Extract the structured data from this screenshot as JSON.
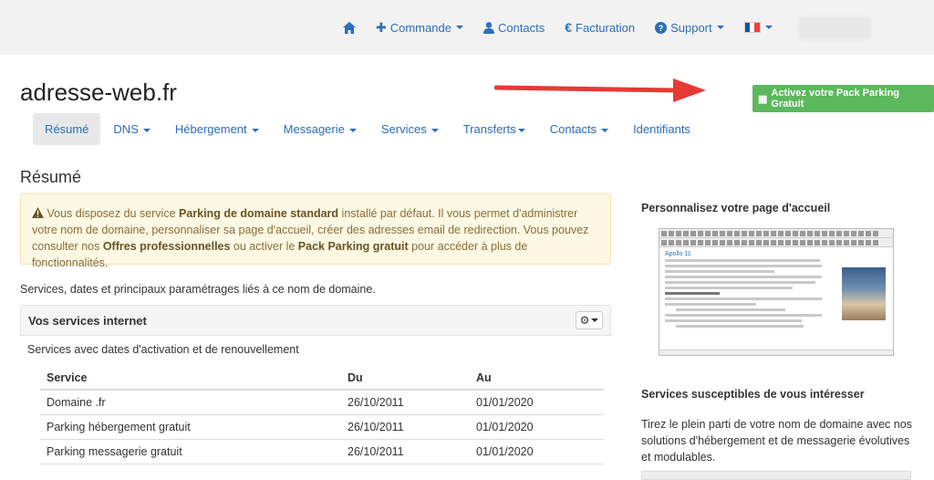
{
  "topnav": {
    "home_icon": "home-icon",
    "items": [
      {
        "label": "Commande",
        "icon": "plus-icon",
        "dropdown": true
      },
      {
        "label": "Contacts",
        "icon": "user-icon",
        "dropdown": false
      },
      {
        "label": "Facturation",
        "icon": "euro-icon",
        "dropdown": false
      },
      {
        "label": "Support",
        "icon": "question-circle-icon",
        "dropdown": true
      }
    ],
    "language_flag": "french-flag-icon"
  },
  "domain": {
    "title": "adresse-web.fr",
    "pack_button": "Activez votre Pack Parking Gratuit"
  },
  "tabs": [
    {
      "label": "Résumé",
      "active": true
    },
    {
      "label": "DNS",
      "dropdown": true
    },
    {
      "label": "Hébergement",
      "dropdown": true
    },
    {
      "label": "Messagerie",
      "dropdown": true
    },
    {
      "label": "Services",
      "dropdown": true
    },
    {
      "label": "Transferts",
      "dropdown": true
    },
    {
      "label": "Contacts",
      "dropdown": true
    },
    {
      "label": "Identifiants",
      "dropdown": false
    }
  ],
  "main": {
    "section_title": "Résumé",
    "alert": {
      "part1": "Vous disposez du service ",
      "bold1": "Parking de domaine standard",
      "part2": " installé par défaut. Il vous permet d'administrer votre nom de domaine, personnaliser sa page d'accueil, créer des adresses email de redirection. Vous pouvez consulter nos ",
      "bold2": "Offres professionnelles",
      "part3": " ou activer le ",
      "bold3": "Pack Parking gratuit",
      "part4": " pour accéder à plus de fonctionnalités."
    },
    "description": "Services, dates et principaux paramétrages liés à ce nom de domaine.",
    "panel": {
      "title": "Vos services internet",
      "subtitle": "Services avec dates d'activation et de renouvellement",
      "columns": [
        "Service",
        "Du",
        "Au"
      ],
      "rows": [
        [
          "Domaine .fr",
          "26/10/2011",
          "01/01/2020"
        ],
        [
          "Parking hébergement gratuit",
          "26/10/2011",
          "01/01/2020"
        ],
        [
          "Parking messagerie gratuit",
          "26/10/2011",
          "01/01/2020"
        ]
      ]
    }
  },
  "sidebar": {
    "custom_title": "Personnalisez votre page d'accueil",
    "editor_heading": "Apollo 11",
    "services_title": "Services susceptibles de vous intéresser",
    "services_text": "Tirez le plein parti de votre nom de domaine avec nos solutions d'hébergement et de messagerie évolutives et modulables."
  },
  "colors": {
    "link": "#2a6ebb",
    "success": "#5cb85c",
    "alert_bg": "#fcf8e3",
    "arrow": "#e53935"
  }
}
